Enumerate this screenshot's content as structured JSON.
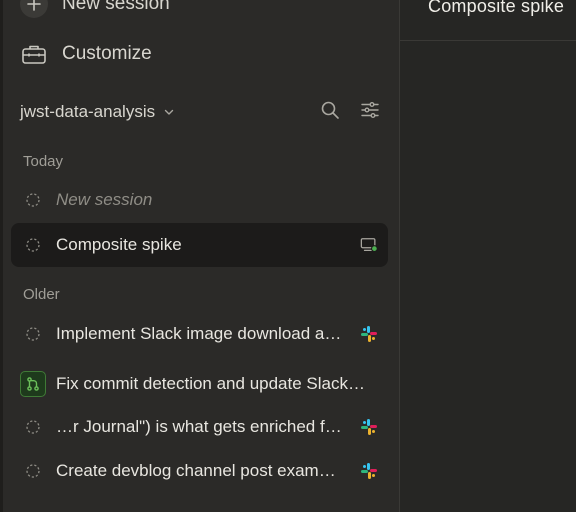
{
  "sidebar": {
    "new_session_label": "New session",
    "customize_label": "Customize",
    "project": {
      "name": "jwst-data-analysis"
    },
    "sections": {
      "today": {
        "label": "Today",
        "sessions": [
          {
            "title": "New session",
            "placeholder": true
          },
          {
            "title": "Composite spike",
            "active": true,
            "trail_icon": "monitor-icon"
          }
        ]
      },
      "older": {
        "label": "Older",
        "sessions": [
          {
            "title": "Implement Slack image download a…",
            "trail_icon": "slack-icon"
          },
          {
            "title": "Fix commit detection and update Slack…",
            "lead_icon": "git-branch-icon"
          },
          {
            "title": "…r Journal\") is what gets enriched f…",
            "trail_icon": "slack-icon"
          },
          {
            "title": "Create devblog channel post exam…",
            "trail_icon": "slack-icon"
          }
        ]
      }
    }
  },
  "main": {
    "title": "Composite spike"
  },
  "colors": {
    "active_dot": "#4caf50",
    "branch_green": "#3f7a36"
  }
}
